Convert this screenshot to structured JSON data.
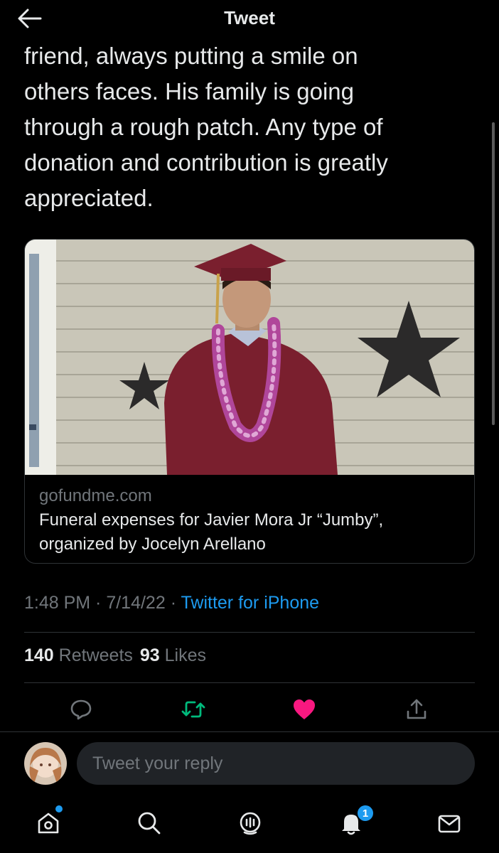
{
  "header": {
    "title": "Tweet",
    "back_icon": "arrow-left-icon"
  },
  "tweet": {
    "text_lines": [
      "friend, always putting a smile on",
      "others faces. His family is going",
      "through a rough patch. Any type of",
      "donation and contribution is greatly",
      "appreciated."
    ]
  },
  "card": {
    "domain": "gofundme.com",
    "title_line1": "Funeral expenses for Javier Mora Jr “Jumby”,",
    "title_line2": "organized by Jocelyn Arellano"
  },
  "meta": {
    "time": "1:48 PM",
    "sep1": " · ",
    "date": "7/14/22",
    "sep2": " · ",
    "source": "Twitter for iPhone"
  },
  "stats": {
    "retweets_count": "140",
    "retweets_label": "Retweets",
    "likes_count": "93",
    "likes_label": "Likes"
  },
  "actions": {
    "reply_icon": "reply-icon",
    "retweet_icon": "retweet-icon",
    "like_icon": "heart-filled-icon",
    "share_icon": "share-icon",
    "retweet_color": "#00ba7c",
    "like_color": "#f91880"
  },
  "reply": {
    "placeholder": "Tweet your reply"
  },
  "tabbar": {
    "items": [
      "home-icon",
      "search-icon",
      "spaces-icon",
      "notifications-icon",
      "messages-icon"
    ],
    "notifications_badge": "1",
    "accent": "#1d9bf0"
  }
}
